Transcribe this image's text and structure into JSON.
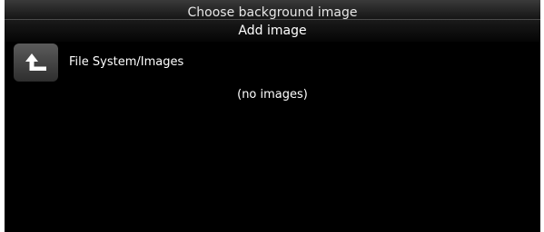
{
  "parent_dialog": {
    "title": "Choose background image"
  },
  "dialog": {
    "title": "Add image"
  },
  "navigation": {
    "up_button_icon": "up-arrow-icon",
    "current_path": "File System/Images"
  },
  "content": {
    "empty_message": "(no images)"
  },
  "colors": {
    "background": "#000000",
    "text": "#ffffff",
    "button": "#4a4a4a"
  }
}
